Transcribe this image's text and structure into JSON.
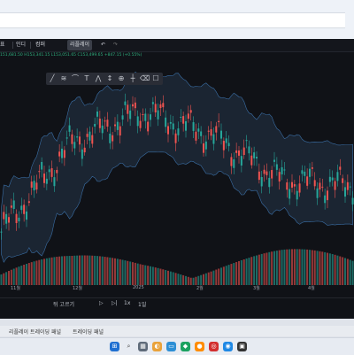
{
  "toolbar": {
    "menu_label": "표",
    "indicator_label": "인디",
    "compare_label": "컴퍼",
    "replay_label": "리플레이",
    "undo_icon": "undo-icon",
    "redo_icon": "redo-icon"
  },
  "ohlc_text": "151,681.50  H153,341.15  L153,051.65  C153,499.65 +847.15 (+0.55%)",
  "drawing_tools": [
    "line-tool-icon",
    "fib-tool-icon",
    "brush-tool-icon",
    "text-tool-icon",
    "pattern-tool-icon",
    "measure-tool-icon",
    "zoom-tool-icon",
    "ruler-tool-icon",
    "eraser-tool-icon",
    "rectangle-tool-icon"
  ],
  "x_axis_labels": [
    "11월",
    "12월",
    "2025",
    "2월",
    "3월",
    "4월"
  ],
  "replay_bar": {
    "back_label": "뒤 고르기",
    "play_icon": "play-icon",
    "step_icon": "step-forward-icon",
    "speed_label": "1x",
    "interval_label": "1일"
  },
  "bottom_tabs": [
    "리플레이 트레이딩 패널",
    "트레이딩 패널"
  ],
  "colors": {
    "background": "#101217",
    "up": "#26a69a",
    "down": "#ef5350",
    "bollinger": "#3a6ea5",
    "band_fill": "#1e2a3a"
  },
  "chart_data": {
    "type": "candlestick",
    "x": [
      "11월",
      "12월",
      "2025",
      "2월",
      "3월",
      "4월"
    ],
    "series": [
      {
        "values": [
          40,
          95,
          115,
          100,
          72,
          68
        ]
      }
    ],
    "volume": [
      30,
      22,
      18,
      20,
      25,
      28
    ],
    "xlabel": "",
    "ylabel": ""
  }
}
